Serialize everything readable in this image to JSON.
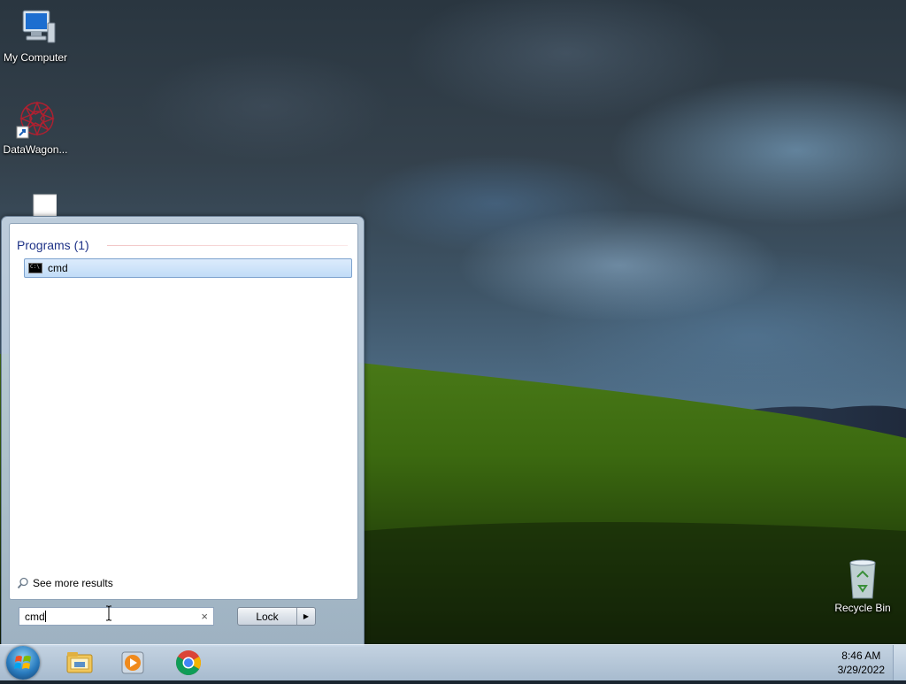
{
  "desktop": {
    "icons": [
      {
        "label": "My Computer"
      },
      {
        "label": "DataWagon..."
      },
      {
        "label": ""
      },
      {
        "label": "Recycle Bin"
      }
    ]
  },
  "start_menu": {
    "group_title": "Programs (1)",
    "results": [
      {
        "label": "cmd",
        "icon": "cmd-icon"
      }
    ],
    "see_more": "See more results",
    "search": {
      "value": "cmd",
      "clear_glyph": "×"
    },
    "power_button": {
      "label": "Lock",
      "arrow_glyph": "▶"
    }
  },
  "taskbar": {
    "pinned": [
      "windows-explorer-icon",
      "media-player-icon",
      "chrome-icon"
    ],
    "clock": {
      "time": "8:46 AM",
      "date": "3/29/2022"
    }
  }
}
